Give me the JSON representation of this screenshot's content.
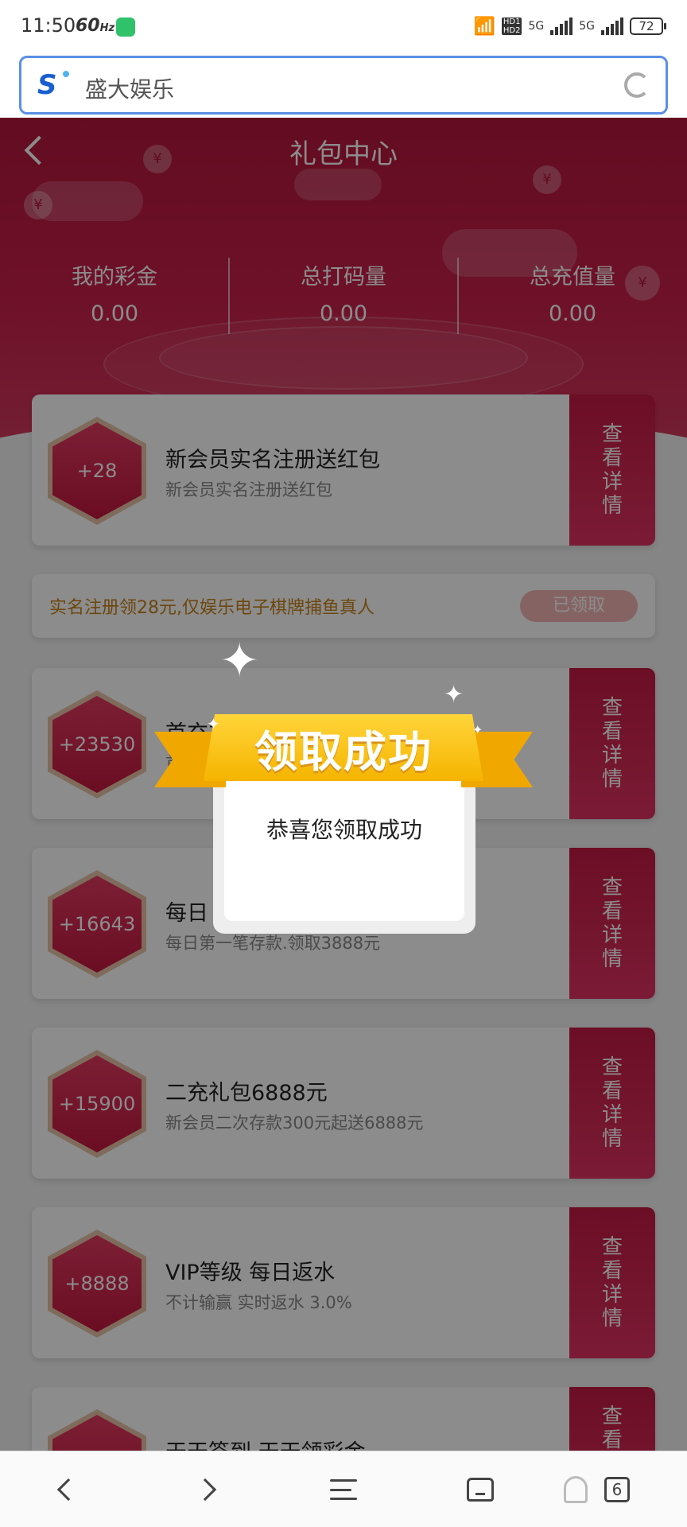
{
  "status_bar": {
    "time": "11:50",
    "refresh_rate": "60",
    "network_1": "5G",
    "network_2": "5G",
    "hd_1": "HD1",
    "hd_2": "HD2",
    "battery": "72"
  },
  "browser": {
    "address_text": "盛大娱乐",
    "tab_count": "6"
  },
  "header": {
    "title": "礼包中心"
  },
  "stats": [
    {
      "label": "我的彩金",
      "value": "0.00"
    },
    {
      "label": "总打码量",
      "value": "0.00"
    },
    {
      "label": "总充值量",
      "value": "0.00"
    }
  ],
  "cards": [
    {
      "amount": "+28",
      "title": "新会员实名注册送红包",
      "subtitle": "新会员实名注册送红包",
      "button": [
        "查",
        "看",
        "详",
        "情"
      ]
    },
    {
      "amount": "+23530",
      "title": "首充礼包",
      "subtitle": "首",
      "button": [
        "查",
        "看",
        "详",
        "情"
      ]
    },
    {
      "amount": "+16643",
      "title": "每日",
      "subtitle": "每日第一笔存款.领取3888元",
      "button": [
        "查",
        "看",
        "详",
        "情"
      ]
    },
    {
      "amount": "+15900",
      "title": "二充礼包6888元",
      "subtitle": "新会员二次存款300元起送6888元",
      "button": [
        "查",
        "看",
        "详",
        "情"
      ]
    },
    {
      "amount": "+8888",
      "title": "VIP等级 每日返水",
      "subtitle": "不计输赢 实时返水 3.0%",
      "button": [
        "查",
        "看",
        "详",
        "情"
      ]
    },
    {
      "amount": "",
      "title": "天天签到 天天领彩金",
      "subtitle": "",
      "button": [
        "查",
        "看"
      ]
    }
  ],
  "claim_bar": {
    "text": "实名注册领28元,仅娱乐电子棋牌捕鱼真人",
    "button": "已领取"
  },
  "modal": {
    "ribbon_title": "领取成功",
    "message": "恭喜您领取成功"
  },
  "colors": {
    "brand_red": "#c41a43",
    "ribbon_gold": "#ffc21a",
    "address_border": "#5a8fe6"
  }
}
